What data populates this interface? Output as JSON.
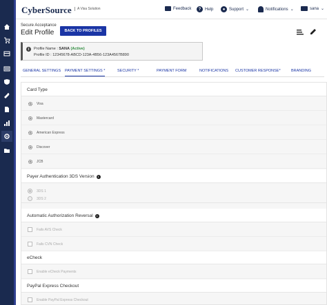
{
  "header": {
    "brand": "CyberSource",
    "brand_sub": "A Visa Solution",
    "feedback": "Feedback",
    "help": "Help",
    "support": "Support",
    "notifications": "Notifications",
    "user": "sana"
  },
  "page": {
    "crumb": "Secure Acceptance",
    "title": "Edit Profile",
    "back_button": "BACK TO PROFILES"
  },
  "profile": {
    "name_label": "Profile Name :",
    "name_value": "SANA",
    "status": "(Active)",
    "id_label": "Profile ID :",
    "id_value": "12345678-ABCD-123A-4B56-123A4567B890"
  },
  "tabs": [
    {
      "label": "GENERAL SETTINGS"
    },
    {
      "label": "PAYMENT SETTINGS *"
    },
    {
      "label": "SECURITY *"
    },
    {
      "label": "PAYMENT FORM"
    },
    {
      "label": "NOTIFICATIONS"
    },
    {
      "label": "CUSTOMER RESPONSE*"
    },
    {
      "label": "BRANDING"
    }
  ],
  "card_type": {
    "title": "Card Type",
    "options": [
      "Visa",
      "Mastercard",
      "American Express",
      "Discover",
      "JCB"
    ]
  },
  "payer_auth": {
    "title": "Payer Authentication 3DS Version",
    "options": [
      "3DS 1",
      "3DS 2"
    ]
  },
  "auth_reversal": {
    "title": "Automatic Authorization Reversal",
    "options": [
      "Fails AVS Check",
      "Fails CVN Check"
    ]
  },
  "echeck": {
    "title": "eCheck",
    "option": "Enable eCheck Payments"
  },
  "paypal": {
    "title": "PayPal Express Checkout",
    "option": "Enable PayPal Express Checkout"
  },
  "colors": {
    "sidebar": "#1a2a4f",
    "accent_blue": "#1a35a5",
    "active_green": "#2e8b3e"
  }
}
